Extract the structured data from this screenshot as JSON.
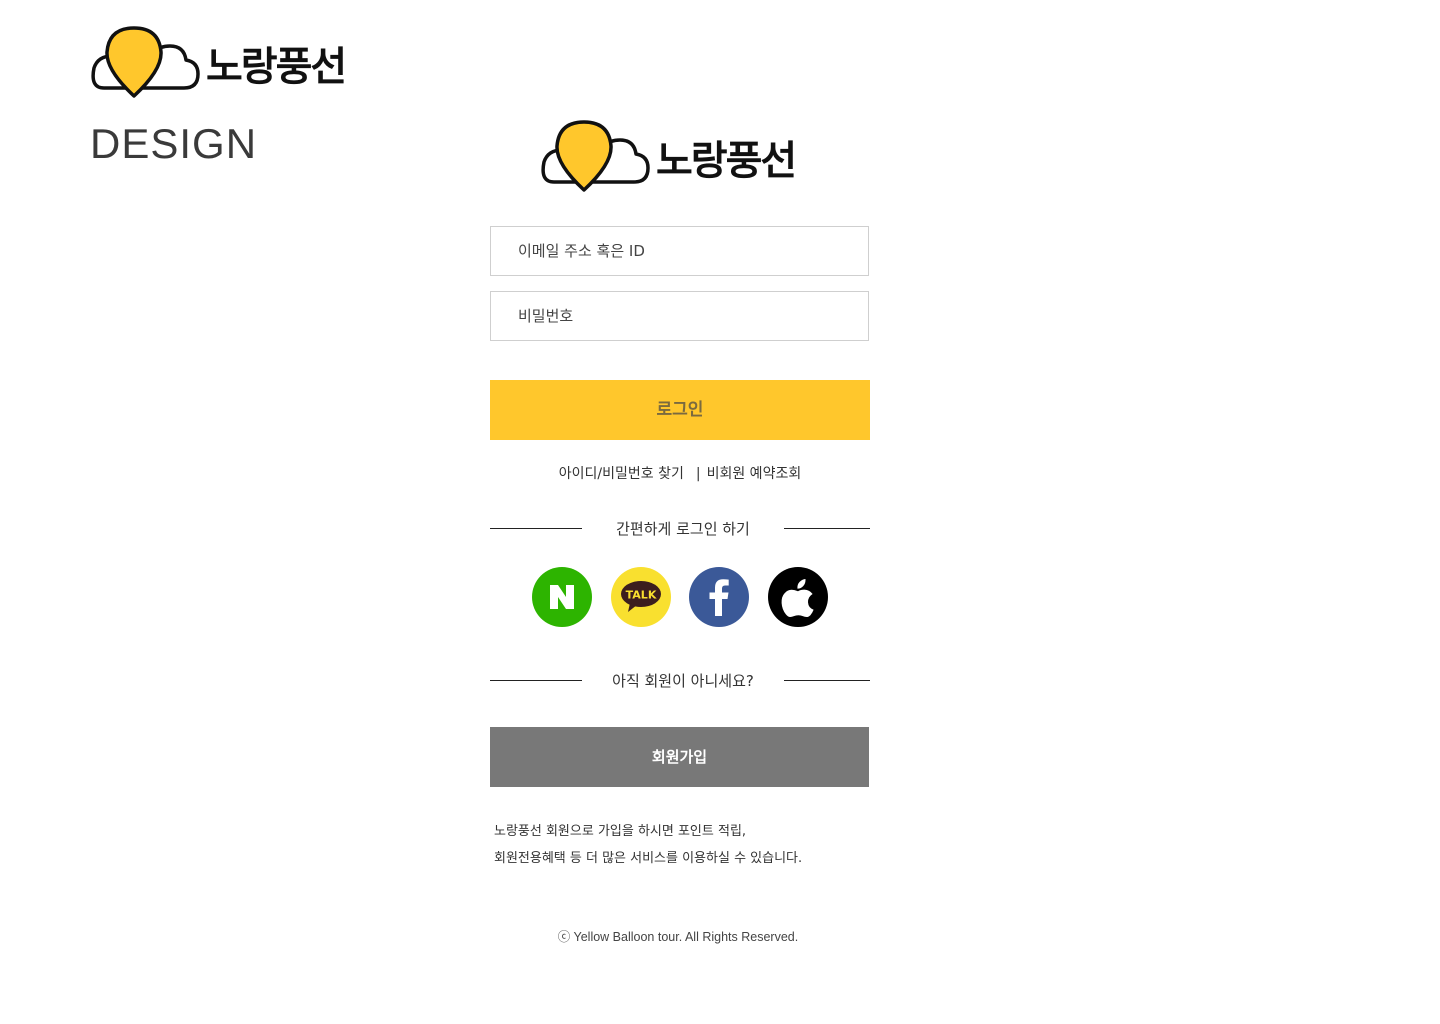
{
  "brand": {
    "name": "노랑풍선",
    "design_label": "DESIGN",
    "balloon_color": "#ffc72c"
  },
  "login": {
    "email_placeholder": "이메일 주소 혹은 ID",
    "password_placeholder": "비밀번호",
    "login_button": "로그인",
    "find_id_pw": "아이디/비밀번호 찾기",
    "separator": "|",
    "guest_reservation": "비회원 예약조회",
    "easy_login_title": "간편하게 로그인 하기"
  },
  "social": [
    {
      "name": "naver",
      "label": "N",
      "color": "#2db400"
    },
    {
      "name": "kakao",
      "label": "TALK",
      "color": "#f9e02f"
    },
    {
      "name": "facebook",
      "label": "f",
      "color": "#3b5998"
    },
    {
      "name": "apple",
      "label": "",
      "color": "#000000"
    }
  ],
  "join": {
    "prompt": "아직 회원이 아니세요?",
    "button": "회원가입",
    "info_line1": "노랑풍선 회원으로 가입을 하시면 포인트 적립,",
    "info_line2": "회원전용혜택 등 더 많은 서비스를 이용하실 수 있습니다."
  },
  "footer": {
    "copyright": "ⓒ Yellow Balloon tour. All Rights Reserved."
  }
}
